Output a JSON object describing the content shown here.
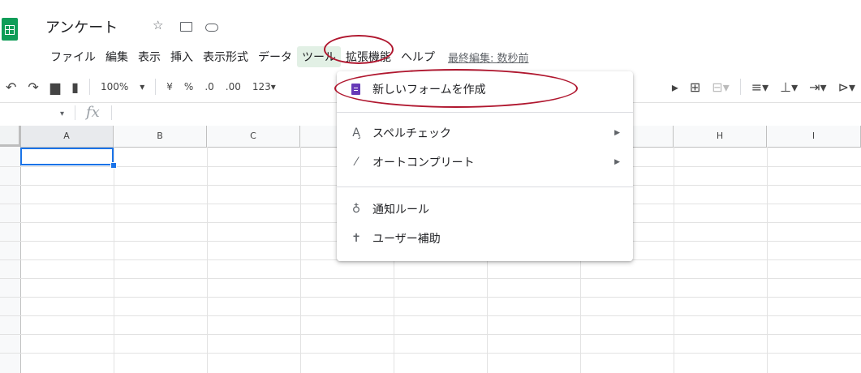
{
  "document": {
    "title": "アンケート"
  },
  "menubar": {
    "items": [
      "ファイル",
      "編集",
      "表示",
      "挿入",
      "表示形式",
      "データ",
      "ツール",
      "拡張機能",
      "ヘルプ"
    ],
    "active_index": 6,
    "last_edit": "最終編集: 数秒前"
  },
  "toolbar": {
    "zoom": "100%",
    "currency": "¥",
    "percent": "%",
    "decrease_decimal": ".0",
    "increase_decimal": ".00",
    "format_more": "123▾"
  },
  "formula_bar": {
    "fx": "fx"
  },
  "grid": {
    "columns": [
      "A",
      "B",
      "C",
      "H",
      "I"
    ],
    "selected_cell": "A1"
  },
  "tools_menu": {
    "items": [
      {
        "label": "新しいフォームを作成",
        "icon": "forms-icon",
        "submenu": false
      },
      {
        "label": "スペルチェック",
        "icon": "spellcheck-icon",
        "submenu": true
      },
      {
        "label": "オートコンプリート",
        "icon": "magic-wand-icon",
        "submenu": true
      },
      {
        "label": "通知ルール",
        "icon": "bell-icon",
        "submenu": false
      },
      {
        "label": "ユーザー補助",
        "icon": "accessibility-icon",
        "submenu": false
      }
    ]
  },
  "colors": {
    "sheets_green": "#0f9d58",
    "selection_blue": "#1a73e8",
    "annotation_red": "#b0172f",
    "forms_purple": "#673ab7"
  }
}
